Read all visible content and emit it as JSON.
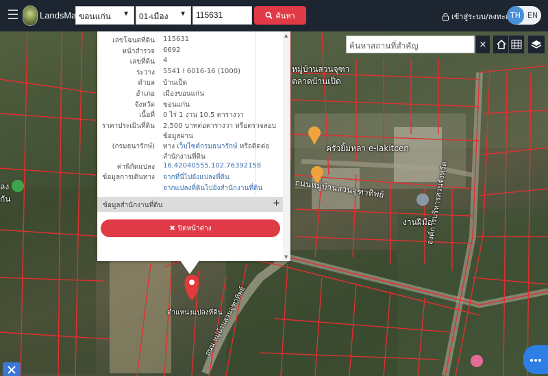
{
  "app": {
    "brand": "LandsMaps"
  },
  "search": {
    "province": "ขอนแก่น",
    "district": "01-เมืองขอนแก่น",
    "parcel_number": "115631",
    "button_label": "ค้นหา"
  },
  "auth": {
    "login_label": "เข้าสู่ระบบ/ลงทะเบียน"
  },
  "language": {
    "active": "TH",
    "other": "EN"
  },
  "place_search": {
    "placeholder": "ค้นหาสถานที่สำคัญ"
  },
  "popup": {
    "fields": [
      {
        "label": "เลขโฉนดที่ดิน",
        "value": "115631"
      },
      {
        "label": "หน้าสำรวจ",
        "value": "6692"
      },
      {
        "label": "เลขที่ดิน",
        "value": "4"
      },
      {
        "label": "ระวาง",
        "value": "5541 I 6016-16 (1000)"
      },
      {
        "label": "ตำบล",
        "value": "บ้านเป็ด"
      },
      {
        "label": "อำเภอ",
        "value": "เมืองขอนแก่น"
      },
      {
        "label": "จังหวัด",
        "value": "ขอนแก่น"
      },
      {
        "label": "เนื้อที่",
        "value": "0 ไร่ 1 งาน 10.5 ตารางวา"
      }
    ],
    "appraisal_label_1": "ราคาประเมินที่ดิน",
    "appraisal_label_2": "(กรมธนารักษ์)",
    "appraisal_value_1": "2,500 บาทต่อตารางวา หรือตรวจสอบข้อมูลผ่าน",
    "appraisal_value_2_prefix": "ทาง",
    "appraisal_value_2_link": "เว็บไซต์กรมธนารักษ์",
    "appraisal_value_2_suffix": "หรือติดต่อสำนักงานที่ดิน",
    "coords_label": "ค่าพิกัดแปลง",
    "coords_value": "16.42040555,102.76392158",
    "route_label": "ข้อมูลการเดินทาง",
    "route_link_1": "จากที่นี่ไปยังแปลงที่ดิน",
    "route_link_2": "จากแปลงที่ดินไปยังสำนักงานที่ดิน",
    "office_section": "ข้อมูลสำนักงานที่ดิน",
    "office_toggle": "+",
    "close_label": "ปิดหน้าต่าง"
  },
  "map_labels": {
    "pin_label": "ตำแหน่งแปลงที่ดิน",
    "village_road": "ถนนหมู่บ้านสวนจุฑาทิพย์",
    "kitchen": "ครัวยิ้มหลา e-lakitcen",
    "temple_top_1": "หมู่บ้านสวนจุฑา",
    "temple_top_2": "ตลาดบ้านเป็ด",
    "road_right": "องค์การบริหารส่วนจังหวัด",
    "shop": "งานฝีมือ",
    "left_label_1": "ลง",
    "left_label_2": "กัน",
    "bottom_road": "ถนน หมู่บ้านสวนจุฑาทิพย์"
  },
  "icons": {
    "search": "search-icon",
    "lock": "lock-icon",
    "home": "home-icon",
    "grid": "grid-icon",
    "layers": "layers-icon",
    "close": "close-icon",
    "chat": "chat-icon"
  },
  "colors": {
    "topbar": "#1c2530",
    "accent_red": "#e03a46",
    "parcel_line": "#e23030",
    "link_blue": "#3a6fb0",
    "lang_active": "#4a90d9"
  }
}
